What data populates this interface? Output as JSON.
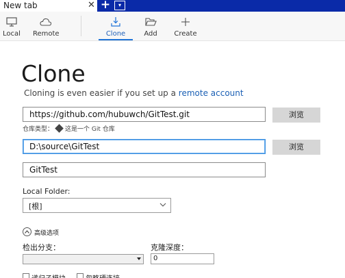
{
  "tabs": {
    "active_title": "New tab",
    "close_glyph": "✕",
    "new_tab_glyph": "+",
    "menu_glyph": "▾"
  },
  "toolbar": {
    "items": [
      {
        "label": "Local",
        "icon": "monitor-icon"
      },
      {
        "label": "Remote",
        "icon": "cloud-icon"
      },
      {
        "label": "Clone",
        "icon": "download-tray-icon",
        "active": true
      },
      {
        "label": "Add",
        "icon": "folder-open-icon"
      },
      {
        "label": "Create",
        "icon": "plus-icon"
      }
    ]
  },
  "clone": {
    "title": "Clone",
    "subtitle_text": "Cloning is even easier if you set up a ",
    "subtitle_link": "remote account",
    "url_value": "https://github.com/hubuwch/GitTest.git",
    "browse_label_1": "浏览",
    "repo_type_label": "仓库类型：",
    "repo_type_value": "这是一个 Git 仓库",
    "dest_value": "D:\\source\\GitTest",
    "browse_label_2": "浏览",
    "name_value": "GitTest",
    "local_folder_label": "Local Folder:",
    "local_folder_value": "[根]",
    "advanced_label": "高级选项",
    "checkout_branch_label": "检出分支：",
    "clone_depth_label": "克隆深度：",
    "clone_depth_value": "0",
    "recurse_submodules_label": "递归子模块",
    "no_hardlinks_label": "忽略硬连接"
  },
  "colors": {
    "accent": "#1e73d8",
    "tab_bar": "#0a2aa8",
    "link": "#1a5fb4",
    "button_bg": "#d6d6d6"
  }
}
